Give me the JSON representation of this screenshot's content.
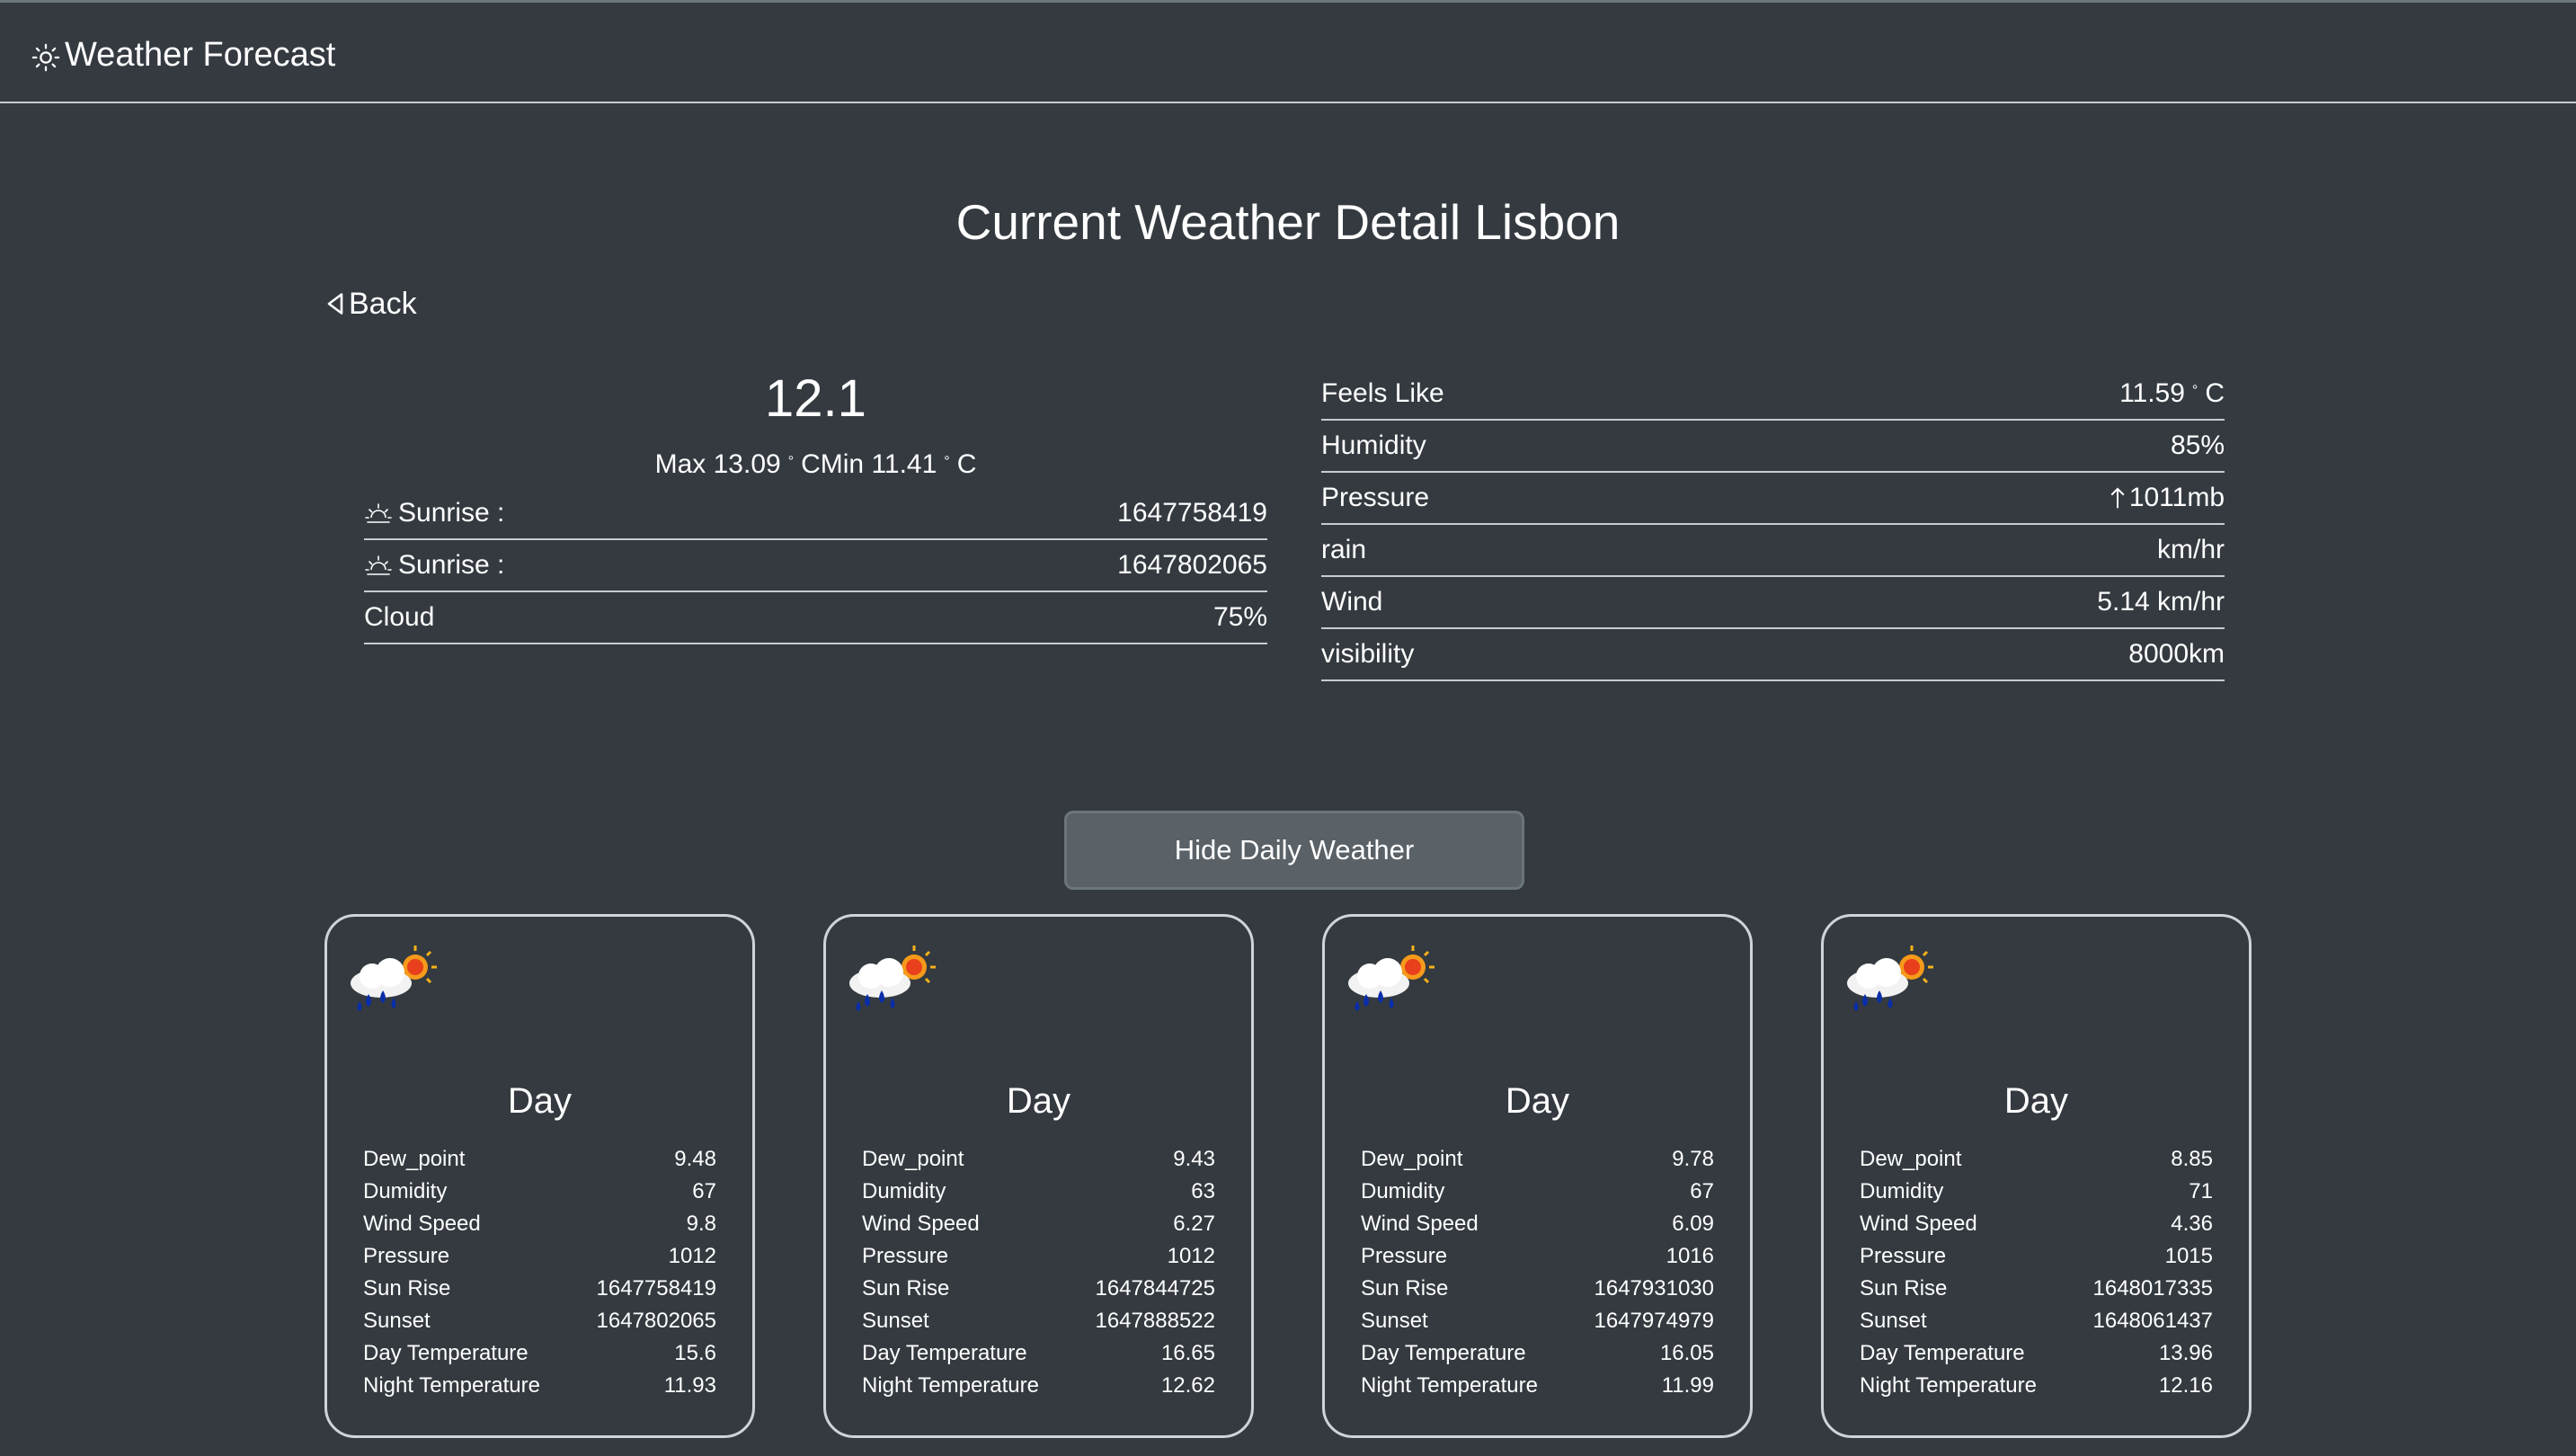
{
  "app": {
    "title": "Weather Forecast",
    "icon": "sun-icon"
  },
  "page": {
    "title": "Current Weather Detail Lisbon",
    "back_label": "Back"
  },
  "current": {
    "temp": "12.1",
    "max_label": "Max 13.09",
    "min_label": "CMin 11.41",
    "unit": "C",
    "deg_symbol": "°",
    "sunrise_label": "Sunrise :",
    "sunrise_value": "1647758419",
    "sunset_label": "Sunrise :",
    "sunset_value": "1647802065",
    "cloud_label": "Cloud",
    "cloud_value": "75%"
  },
  "details": {
    "feels_like_label": "Feels Like",
    "feels_like_value": "11.59",
    "feels_like_unit": "C",
    "humidity_label": "Humidity",
    "humidity_value": "85%",
    "pressure_label": "Pressure",
    "pressure_value": "1011mb",
    "rain_label": "rain",
    "rain_value": "km/hr",
    "wind_label": "Wind",
    "wind_value": "5.14 km/hr",
    "visibility_label": "visibility",
    "visibility_value": "8000km"
  },
  "toggle_button": "Hide Daily Weather",
  "daily": [
    {
      "title": "Day",
      "icon": "rain-cloud-sun-icon",
      "rows": [
        {
          "label": "Dew_point",
          "value": "9.48"
        },
        {
          "label": "Dumidity",
          "value": "67"
        },
        {
          "label": "Wind Speed",
          "value": "9.8"
        },
        {
          "label": "Pressure",
          "value": "1012"
        },
        {
          "label": "Sun Rise",
          "value": "1647758419"
        },
        {
          "label": "Sunset",
          "value": "1647802065"
        },
        {
          "label": "Day Temperature",
          "value": "15.6"
        },
        {
          "label": "Night Temperature",
          "value": "11.93"
        }
      ]
    },
    {
      "title": "Day",
      "icon": "rain-cloud-sun-icon",
      "rows": [
        {
          "label": "Dew_point",
          "value": "9.43"
        },
        {
          "label": "Dumidity",
          "value": "63"
        },
        {
          "label": "Wind Speed",
          "value": "6.27"
        },
        {
          "label": "Pressure",
          "value": "1012"
        },
        {
          "label": "Sun Rise",
          "value": "1647844725"
        },
        {
          "label": "Sunset",
          "value": "1647888522"
        },
        {
          "label": "Day Temperature",
          "value": "16.65"
        },
        {
          "label": "Night Temperature",
          "value": "12.62"
        }
      ]
    },
    {
      "title": "Day",
      "icon": "rain-cloud-sun-icon",
      "rows": [
        {
          "label": "Dew_point",
          "value": "9.78"
        },
        {
          "label": "Dumidity",
          "value": "67"
        },
        {
          "label": "Wind Speed",
          "value": "6.09"
        },
        {
          "label": "Pressure",
          "value": "1016"
        },
        {
          "label": "Sun Rise",
          "value": "1647931030"
        },
        {
          "label": "Sunset",
          "value": "1647974979"
        },
        {
          "label": "Day Temperature",
          "value": "16.05"
        },
        {
          "label": "Night Temperature",
          "value": "11.99"
        }
      ]
    },
    {
      "title": "Day",
      "icon": "rain-cloud-sun-icon",
      "rows": [
        {
          "label": "Dew_point",
          "value": "8.85"
        },
        {
          "label": "Dumidity",
          "value": "71"
        },
        {
          "label": "Wind Speed",
          "value": "4.36"
        },
        {
          "label": "Pressure",
          "value": "1015"
        },
        {
          "label": "Sun Rise",
          "value": "1648017335"
        },
        {
          "label": "Sunset",
          "value": "1648061437"
        },
        {
          "label": "Day Temperature",
          "value": "13.96"
        },
        {
          "label": "Night Temperature",
          "value": "12.16"
        }
      ]
    }
  ]
}
